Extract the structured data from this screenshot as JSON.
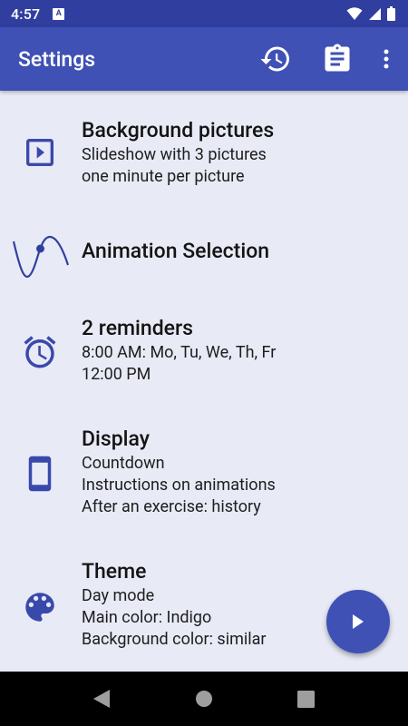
{
  "status_bar": {
    "time": "4:57",
    "notification_letter": "A",
    "icons": [
      "wifi-icon",
      "signal-icon",
      "battery-icon"
    ]
  },
  "app_bar": {
    "title": "Settings",
    "actions": [
      "history-icon",
      "clipboard-icon",
      "more-vert-icon"
    ]
  },
  "settings": {
    "background": {
      "icon": "slideshow-icon",
      "title": "Background pictures",
      "subtitle": [
        "Slideshow with 3 pictures",
        "one minute per picture"
      ]
    },
    "animation": {
      "icon": "sine-wave-icon",
      "title": "Animation Selection"
    },
    "reminders": {
      "icon": "alarm-clock-icon",
      "title": "2 reminders",
      "subtitle": [
        "8:00 AM: Mo, Tu, We, Th, Fr",
        "12:00 PM"
      ]
    },
    "display": {
      "icon": "phone-icon",
      "title": "Display",
      "subtitle": [
        "Countdown",
        "Instructions on animations",
        "After an exercise: history"
      ]
    },
    "theme": {
      "icon": "palette-icon",
      "title": "Theme",
      "subtitle": [
        "Day mode",
        "Main color: Indigo",
        "Background color: similar"
      ]
    }
  },
  "fab": {
    "icon": "play-icon"
  },
  "nav_bar": {
    "buttons": [
      "back-icon",
      "home-icon",
      "recents-icon"
    ]
  },
  "colors": {
    "primary": "#3f51b5",
    "primary_dark": "#303f9f",
    "background": "#e8eaf6",
    "icon": "#3949ab"
  }
}
